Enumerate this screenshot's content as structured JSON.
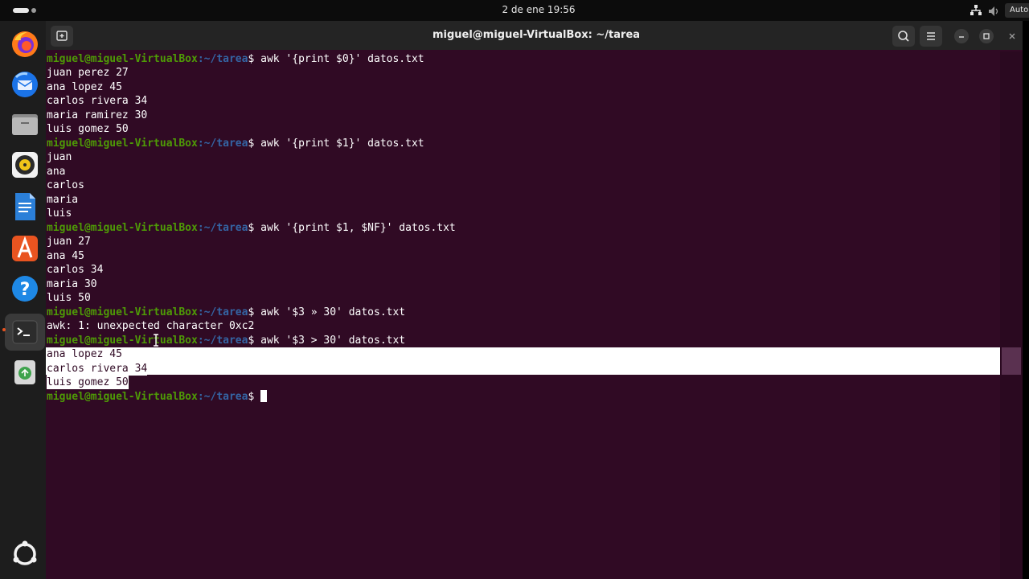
{
  "topbar": {
    "clock": "2 de ene  19:56",
    "tray_label": "Auto"
  },
  "dock": {
    "items": [
      "firefox-icon",
      "thunderbird-icon",
      "files-icon",
      "rhythmbox-icon",
      "writer-icon",
      "app-center-icon",
      "help-icon",
      "terminal-icon",
      "trash-icon",
      "show-apps-icon"
    ]
  },
  "window": {
    "title": "miguel@miguel-VirtualBox: ~/tarea"
  },
  "terminal": {
    "prompt_user": "miguel@miguel-VirtualBox",
    "prompt_path": ":~/tarea",
    "prompt_sign": "$ ",
    "cmd1": "awk '{print $0}' datos.txt",
    "out1": [
      "juan perez 27",
      "ana lopez 45",
      "carlos rivera 34",
      "maria ramirez 30",
      "luis gomez 50"
    ],
    "cmd2": "awk '{print $1}' datos.txt",
    "out2": [
      "juan",
      "ana",
      "carlos",
      "maria",
      "luis"
    ],
    "cmd3": "awk '{print $1, $NF}' datos.txt",
    "out3": [
      "juan 27",
      "ana 45",
      "carlos 34",
      "maria 30",
      "luis 50"
    ],
    "cmd4": "awk '$3 » 30' datos.txt",
    "err4": "awk: 1: unexpected character 0xc2",
    "cmd5": "awk '$3 > 30' datos.txt",
    "out5": [
      "ana lopez 45",
      "carlos rivera 34",
      "luis gomez 50"
    ]
  }
}
